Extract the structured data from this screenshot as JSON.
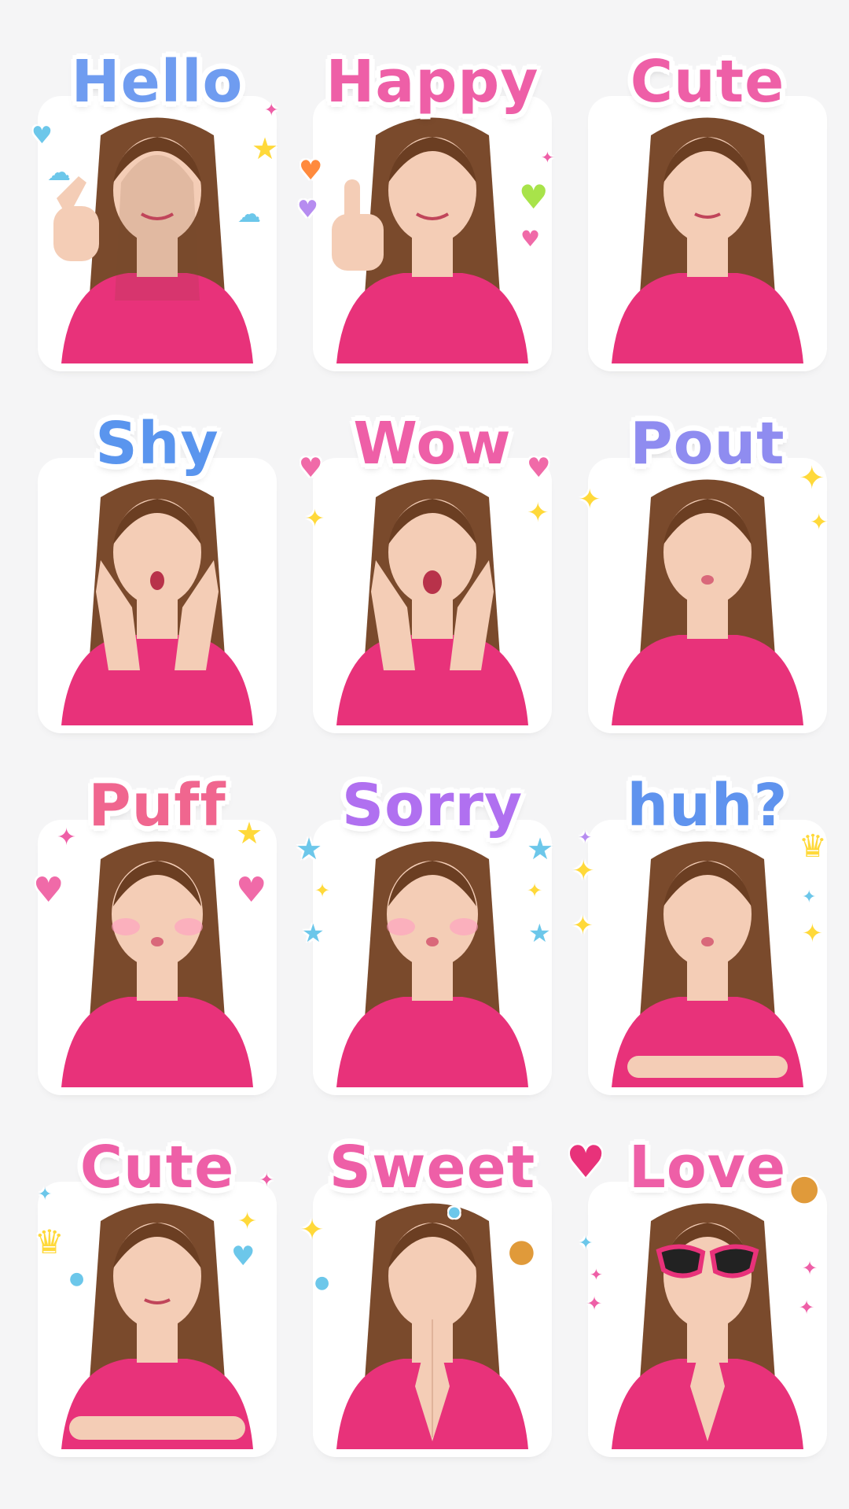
{
  "stickers": [
    {
      "label": "Hello",
      "color": "#6f9cf0",
      "pose": "wave"
    },
    {
      "label": "Happy",
      "color": "#ee5fa7",
      "pose": "thumbs-up"
    },
    {
      "label": "Cute",
      "color": "#ee5fa7",
      "pose": "wink"
    },
    {
      "label": "Shy",
      "color": "#5a95ee",
      "pose": "cheeks"
    },
    {
      "label": "Wow",
      "color": "#ee5fa7",
      "pose": "surprised"
    },
    {
      "label": "Pout",
      "color": "#8f8cf0",
      "pose": "pout"
    },
    {
      "label": "Puff",
      "color": "#f0668f",
      "pose": "puff"
    },
    {
      "label": "Sorry",
      "color": "#b070f0",
      "pose": "puff"
    },
    {
      "label": "huh?",
      "color": "#5f93ee",
      "pose": "arms-crossed"
    },
    {
      "label": "Cute",
      "color": "#ee5fa7",
      "pose": "arms-crossed"
    },
    {
      "label": "Sweet",
      "color": "#ee5fa7",
      "pose": "pray"
    },
    {
      "label": "Love",
      "color": "#ee5fa7",
      "pose": "pray-sunglasses"
    }
  ],
  "palette": {
    "shirt": "#e8327a",
    "hair": "#7a4a2c",
    "skin": "#f4cdb6",
    "background": "#f5f5f6",
    "star_yellow": "#ffd93a",
    "heart_pink": "#f06aa8",
    "cloud_blue": "#6cc7ea"
  }
}
